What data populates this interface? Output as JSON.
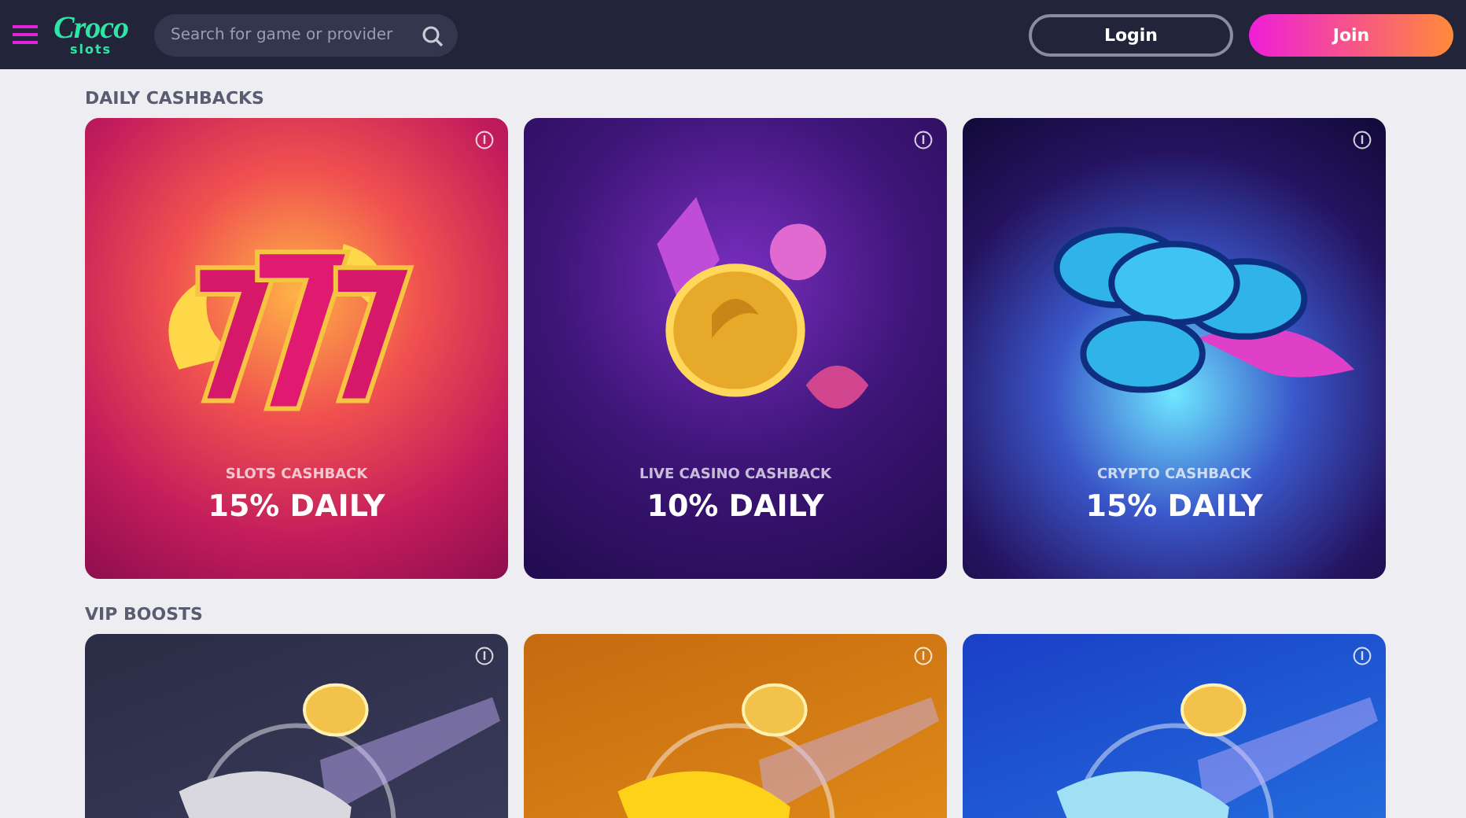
{
  "header": {
    "logo": {
      "title": "Croco",
      "subtitle": "slots"
    },
    "search": {
      "placeholder": "Search for game or provider"
    },
    "buttons": [
      {
        "label": "Login",
        "kind": "outline"
      },
      {
        "label": "Join",
        "kind": "primary"
      }
    ]
  },
  "sections": [
    {
      "title": "DAILY CASHBACKS",
      "cards": [
        {
          "kind": "slots",
          "label": "SLOTS CASHBACK",
          "value": "15% DAILY"
        },
        {
          "kind": "live",
          "label": "LIVE CASINO CASHBACK",
          "value": "10% DAILY"
        },
        {
          "kind": "crypto",
          "label": "CRYPTO CASHBACK",
          "value": "15% DAILY"
        }
      ]
    },
    {
      "title": "VIP BOOSTS",
      "cards": [
        {
          "kind": "silver"
        },
        {
          "kind": "gold"
        },
        {
          "kind": "blue"
        }
      ]
    }
  ]
}
